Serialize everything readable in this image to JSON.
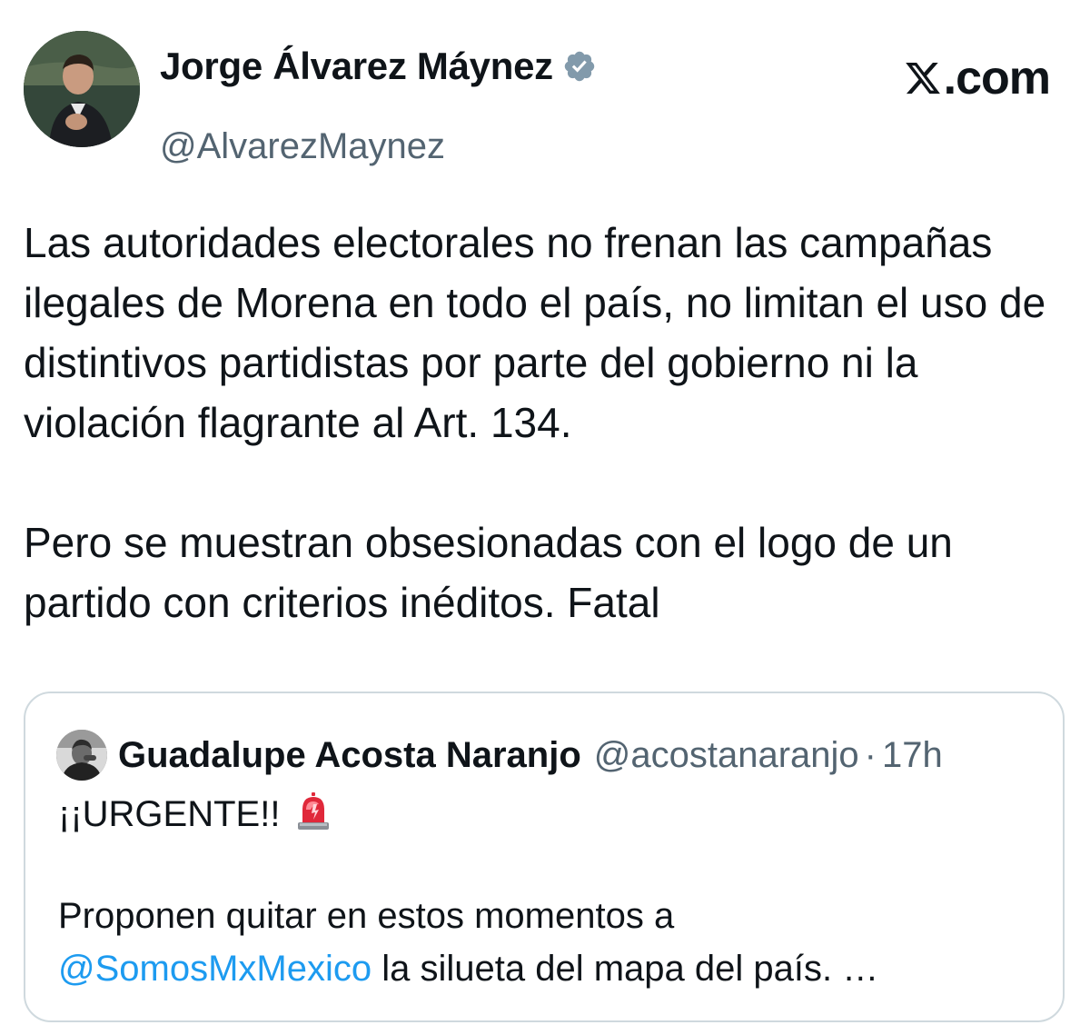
{
  "tweet": {
    "author_name": "Jorge Álvarez Máynez",
    "handle": "@AlvarezMaynez",
    "verified_icon": "verified-badge-icon",
    "paragraphs": [
      "Las autoridades electorales no frenan las campañas ilegales de Morena en todo el país, no limitan el uso de distintivos partidistas por parte del gobierno ni la violación flagrante al Art. 134.",
      "Pero se muestran obsesionadas con el logo de un partido con criterios inéditos. Fatal"
    ]
  },
  "brand": {
    "logo_suffix": ".com",
    "logo_icon": "x-logo-icon"
  },
  "quote": {
    "author_name": "Guadalupe Acosta Naranjo",
    "handle": "@acostanaranjo",
    "separator": "·",
    "time": "17h",
    "line1": "¡¡URGENTE!!",
    "line1_icon": "rotating-light-icon",
    "line2_prefix": "Proponen quitar en estos momentos a",
    "mention": "@SomosMxMexico",
    "line2_suffix": " la silueta del mapa del país. …"
  },
  "colors": {
    "text": "#0f1419",
    "secondary": "#536471",
    "link": "#1d9bf0",
    "verified": "#829aab",
    "border": "#cfd9de"
  }
}
